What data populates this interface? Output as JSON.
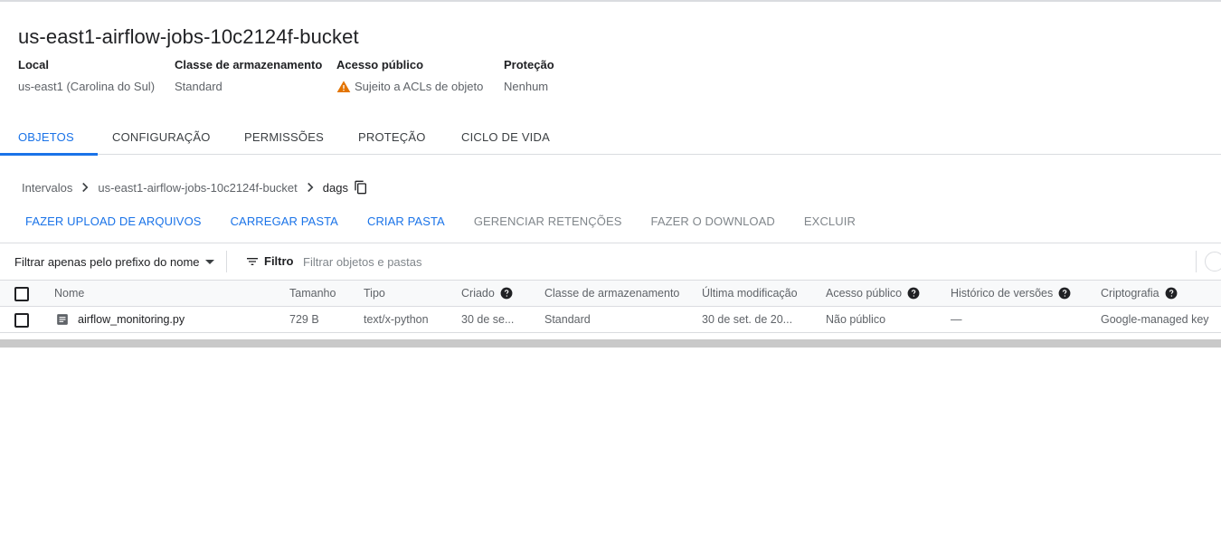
{
  "bucket": {
    "title": "us-east1-airflow-jobs-10c2124f-bucket"
  },
  "properties": [
    {
      "label": "Local",
      "value": "us-east1 (Carolina do Sul)"
    },
    {
      "label": "Classe de armazenamento",
      "value": "Standard"
    },
    {
      "label": "Acesso público",
      "value": "Sujeito a ACLs de objeto",
      "icon": "warning-icon"
    },
    {
      "label": "Proteção",
      "value": "Nenhum"
    }
  ],
  "tabs": [
    {
      "label": "OBJETOS",
      "active": true
    },
    {
      "label": "CONFIGURAÇÃO"
    },
    {
      "label": "PERMISSÕES"
    },
    {
      "label": "PROTEÇÃO"
    },
    {
      "label": "CICLO DE VIDA"
    }
  ],
  "breadcrumb": [
    "Intervalos",
    "us-east1-airflow-jobs-10c2124f-bucket",
    "dags"
  ],
  "actions": [
    {
      "label": "FAZER UPLOAD DE ARQUIVOS",
      "enabled": true
    },
    {
      "label": "CARREGAR PASTA",
      "enabled": true
    },
    {
      "label": "CRIAR PASTA",
      "enabled": true
    },
    {
      "label": "GERENCIAR RETENÇÕES",
      "enabled": false
    },
    {
      "label": "FAZER O DOWNLOAD",
      "enabled": false
    },
    {
      "label": "EXCLUIR",
      "enabled": false
    }
  ],
  "filter": {
    "prefix_label": "Filtrar apenas pelo prefixo do nome",
    "filter_label": "Filtro",
    "placeholder": "Filtrar objetos e pastas"
  },
  "table": {
    "headers": {
      "name": "Nome",
      "size": "Tamanho",
      "type": "Tipo",
      "created": "Criado",
      "storage_class": "Classe de armazenamento",
      "last_modified": "Última modificação",
      "public_access": "Acesso público",
      "version_history": "Histórico de versões",
      "encryption": "Criptografia"
    },
    "rows": [
      {
        "name": "airflow_monitoring.py",
        "size": "729 B",
        "type": "text/x-python",
        "created": "30 de se...",
        "storage_class": "Standard",
        "last_modified": "30 de set. de 20...",
        "public_access": "Não público",
        "version_history": "—",
        "encryption": "Google-managed key"
      }
    ]
  },
  "colors": {
    "accent": "#1a73e8",
    "warning": "#e37400"
  }
}
